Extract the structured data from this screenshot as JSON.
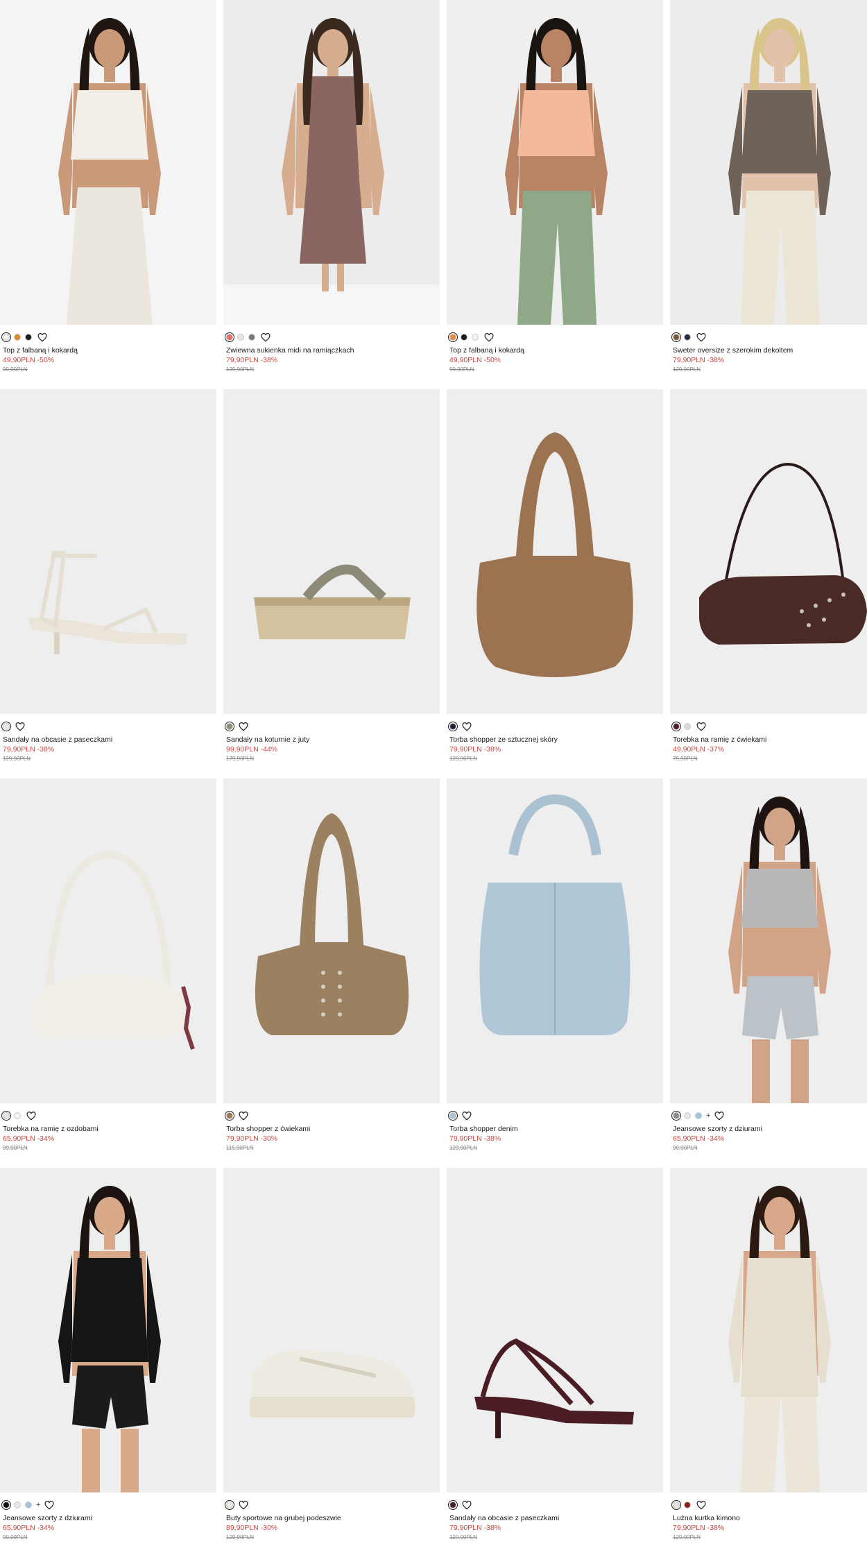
{
  "colors": {
    "sale": "#d0453d",
    "image_bg": "#eeeeee",
    "text": "#1a1a1a"
  },
  "products": [
    {
      "name": "Top z falbaną i kokardą",
      "price": "49,90PLN",
      "discount": "-50%",
      "old_price": "99,90PLN",
      "swatches": [
        "#f2f2f2",
        "#d98a2b",
        "#1b1b1b"
      ],
      "extra": "",
      "image": "model-white-ruffle-top-lace-skirt"
    },
    {
      "name": "Zwiewna sukienka midi na ramiączkach",
      "price": "79,90PLN",
      "discount": "-38%",
      "old_price": "129,90PLN",
      "swatches": [
        "#e86d6d",
        "#e6e6e6",
        "#7a7a7a"
      ],
      "extra": "",
      "image": "model-mauve-slip-dress"
    },
    {
      "name": "Top z falbaną i kokardą",
      "price": "49,90PLN",
      "discount": "-50%",
      "old_price": "99,90PLN",
      "swatches": [
        "#ef8a3a",
        "#1b1b1b",
        "#f2f2f2"
      ],
      "extra": "",
      "image": "model-peach-ruffle-top-green-trousers"
    },
    {
      "name": "Sweter oversize z szerokim dekoltem",
      "price": "79,90PLN",
      "discount": "-38%",
      "old_price": "129,90PLN",
      "swatches": [
        "#7a5a3c",
        "#2b2f45"
      ],
      "extra": "",
      "image": "model-grey-oversize-sweater"
    },
    {
      "name": "Sandały na obcasie z paseczkami",
      "price": "79,90PLN",
      "discount": "-38%",
      "old_price": "129,90PLN",
      "swatches": [
        "#efeee6"
      ],
      "extra": "",
      "image": "cream-strappy-heel-sandal"
    },
    {
      "name": "Sandały na koturnie z juty",
      "price": "99,90PLN",
      "discount": "-44%",
      "old_price": "179,90PLN",
      "swatches": [
        "#8f8f78"
      ],
      "extra": "",
      "image": "jute-wedge-flip-flop"
    },
    {
      "name": "Torba shopper ze sztucznej skóry",
      "price": "79,90PLN",
      "discount": "-38%",
      "old_price": "129,90PLN",
      "swatches": [
        "#20233a"
      ],
      "extra": "",
      "image": "brown-suede-shopper-bag"
    },
    {
      "name": "Torebka na ramię z ćwiekami",
      "price": "49,90PLN",
      "discount": "-37%",
      "old_price": "79,90PLN",
      "swatches": [
        "#4a1f25",
        "#dcdcdc"
      ],
      "extra": "",
      "image": "dark-brown-studded-shoulder-bag"
    },
    {
      "name": "Torebka na ramię z ozdobami",
      "price": "65,90PLN",
      "discount": "-34%",
      "old_price": "99,90PLN",
      "swatches": [
        "#e8e8e0",
        "#f4f4f4"
      ],
      "extra": "",
      "image": "white-shoulder-bag-charm"
    },
    {
      "name": "Torba shopper z ćwiekami",
      "price": "79,90PLN",
      "discount": "-30%",
      "old_price": "115,90PLN",
      "swatches": [
        "#9d7b52"
      ],
      "extra": "",
      "image": "tan-studded-shopper-bag"
    },
    {
      "name": "Torba shopper denim",
      "price": "79,90PLN",
      "discount": "-38%",
      "old_price": "129,90PLN",
      "swatches": [
        "#aac4d0"
      ],
      "extra": "",
      "image": "light-denim-shopper-bag"
    },
    {
      "name": "Jeansowe szorty z dziurami",
      "price": "65,90PLN",
      "discount": "-34%",
      "old_price": "99,90PLN",
      "swatches": [
        "#8c8c8c",
        "#e6e6e6",
        "#a9c3d8"
      ],
      "extra": "+",
      "image": "model-grey-tank-denim-shorts"
    },
    {
      "name": "Jeansowe szorty z dziurami",
      "price": "65,90PLN",
      "discount": "-34%",
      "old_price": "99,90PLN",
      "swatches": [
        "#111111",
        "#e8e8e8",
        "#a9c3d8"
      ],
      "extra": "+",
      "image": "model-black-blouse-black-shorts"
    },
    {
      "name": "Buty sportowe na grubej podeszwie",
      "price": "89,90PLN",
      "discount": "-30%",
      "old_price": "129,90PLN",
      "swatches": [
        "#efece3"
      ],
      "extra": "",
      "image": "cream-chunky-sneaker"
    },
    {
      "name": "Sandały na obcasie z paseczkami",
      "price": "79,90PLN",
      "discount": "-38%",
      "old_price": "129,90PLN",
      "swatches": [
        "#4a1f25"
      ],
      "extra": "",
      "image": "burgundy-strappy-heel-sandal"
    },
    {
      "name": "Luźna kurtka kimono",
      "price": "79,90PLN",
      "discount": "-38%",
      "old_price": "129,90PLN",
      "swatches": [
        "#e9e4d8",
        "#8b1e1e"
      ],
      "extra": "",
      "image": "model-beige-kimono-jacket"
    }
  ]
}
